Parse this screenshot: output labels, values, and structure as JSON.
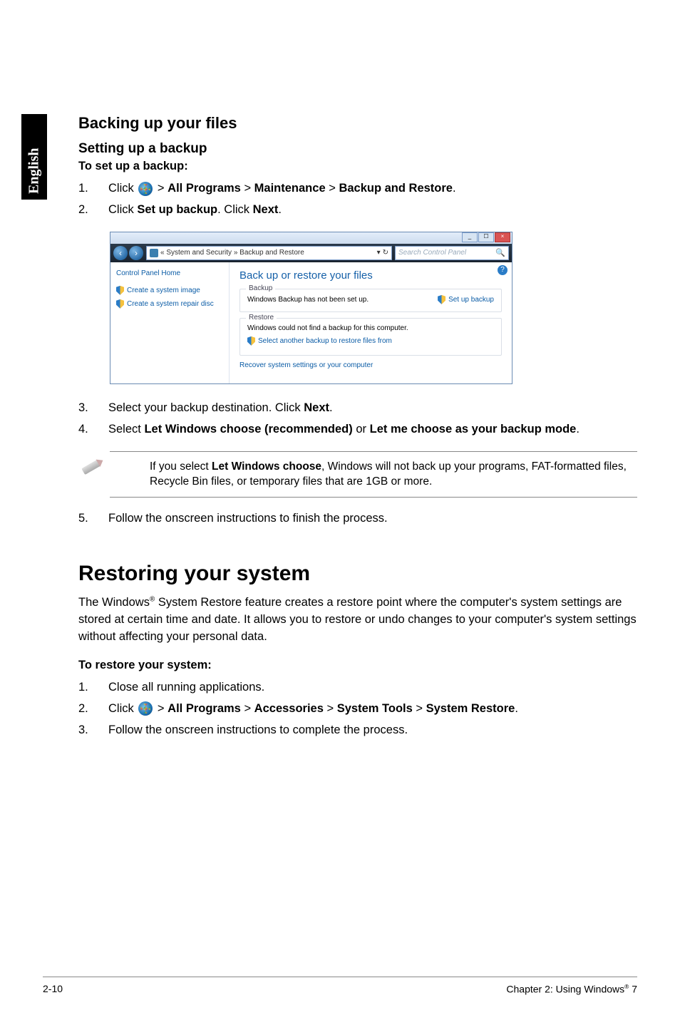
{
  "lang_tab": "English",
  "section_title": "Backing up your files",
  "subsection": "Setting up a backup",
  "lead1": "To set up a backup:",
  "backup_steps": {
    "s1_a": "Click ",
    "s1_b": " > ",
    "s1_allprograms": "All Programs",
    "s1_maintenance": "Maintenance",
    "s1_backuprestore": "Backup and Restore",
    "s1_end": ".",
    "s2_a": "Click ",
    "s2_setup": "Set up backup",
    "s2_b": ". Click ",
    "s2_next": "Next",
    "s2_end": ".",
    "s3_a": "Select your backup destination. Click ",
    "s3_next": "Next",
    "s3_end": ".",
    "s4_a": "Select ",
    "s4_opt1": "Let Windows choose (recommended)",
    "s4_or": " or ",
    "s4_opt2": "Let me choose as your backup mode",
    "s4_end": ".",
    "s5": "Follow the onscreen instructions to finish the process."
  },
  "window": {
    "min": "_",
    "max": "☐",
    "close": "×",
    "back": "‹",
    "fwd": "›",
    "breadcrumb": "« System and Security » Backup and Restore",
    "bc_dd1": "▾",
    "bc_dd2": "↻",
    "search_placeholder": "Search Control Panel",
    "side_home": "Control Panel Home",
    "side_create_image": "Create a system image",
    "side_create_disc": "Create a system repair disc",
    "help": "?",
    "main_heading": "Back up or restore your files",
    "backup_legend": "Backup",
    "backup_status": "Windows Backup has not been set up.",
    "setup_backup": "Set up backup",
    "restore_legend": "Restore",
    "restore_status": "Windows could not find a backup for this computer.",
    "restore_select": "Select another backup to restore files from",
    "recover": "Recover system settings or your computer"
  },
  "note": {
    "a": "If you select ",
    "bold": "Let Windows choose",
    "b": ", Windows will not back up your programs, FAT-formatted files, Recycle Bin files, or temporary files that are 1GB or more."
  },
  "restore_heading": "Restoring your system",
  "restore_intro_a": "The Windows",
  "restore_intro_b": " System Restore feature creates a restore point where the computer's system settings are stored at certain time and date. It allows you to restore or undo changes to your computer's system settings without affecting your personal data.",
  "lead2": "To restore your system:",
  "restore_steps": {
    "s1": "Close all running applications.",
    "s2_a": "Click ",
    "s2_b": " > ",
    "s2_allprograms": "All Programs",
    "s2_accessories": "Accessories",
    "s2_systools": "System Tools",
    "s2_sysrestore": "System Restore",
    "s2_end": ".",
    "s3": "Follow the onscreen instructions to complete the process."
  },
  "footer": {
    "left": "2-10",
    "right_a": "Chapter 2: Using Windows",
    "right_b": " 7"
  },
  "reg": "®"
}
